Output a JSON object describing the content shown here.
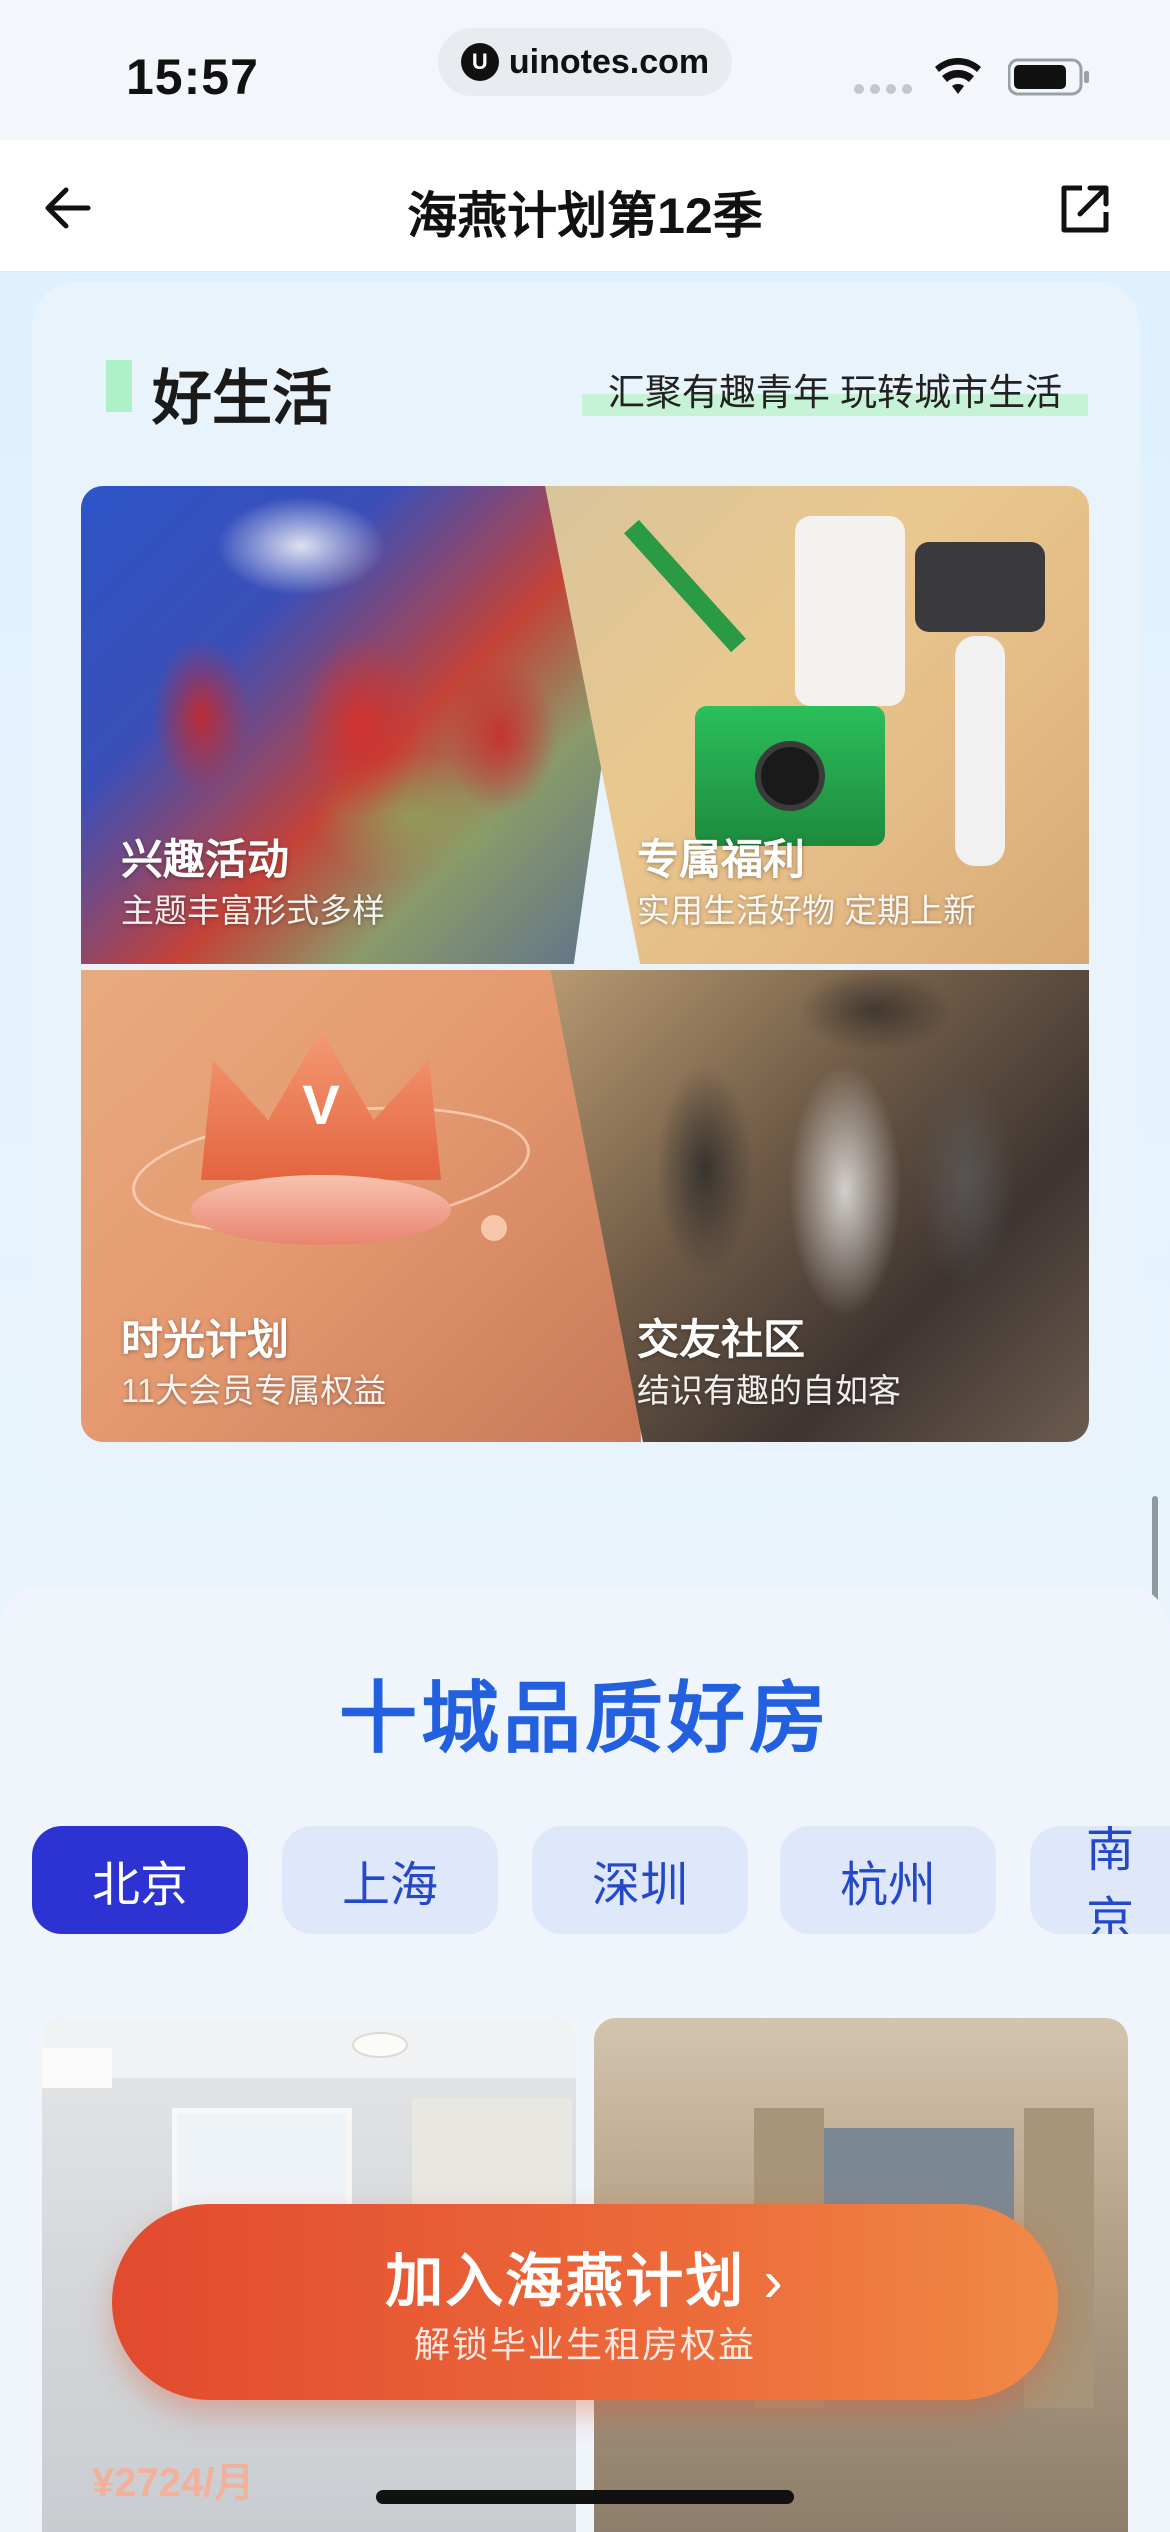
{
  "status_bar": {
    "time": "15:57",
    "url": "uinotes.com"
  },
  "nav": {
    "title": "海燕计划第12季"
  },
  "life_section": {
    "title": "好生活",
    "slogan": "汇聚有趣青年 玩转城市生活",
    "tiles": [
      {
        "title": "兴趣活动",
        "subtitle": "主题丰富形式多样"
      },
      {
        "title": "专属福利",
        "subtitle": "实用生活好物 定期上新"
      },
      {
        "title": "时光计划",
        "subtitle": "11大会员专属权益"
      },
      {
        "title": "交友社区",
        "subtitle": "结识有趣的自如客"
      }
    ]
  },
  "rooms_section": {
    "title": "十城品质好房",
    "cities": [
      "北京",
      "上海",
      "深圳",
      "杭州",
      "南京"
    ],
    "active_city": "北京",
    "price": "¥2724/月"
  },
  "cta": {
    "title": "加入海燕计划",
    "subtitle": "解锁毕业生租房权益"
  },
  "colors": {
    "accent_blue": "#2360e0",
    "tab_active": "#2d33d3",
    "cta_orange": "#e24a2e"
  }
}
